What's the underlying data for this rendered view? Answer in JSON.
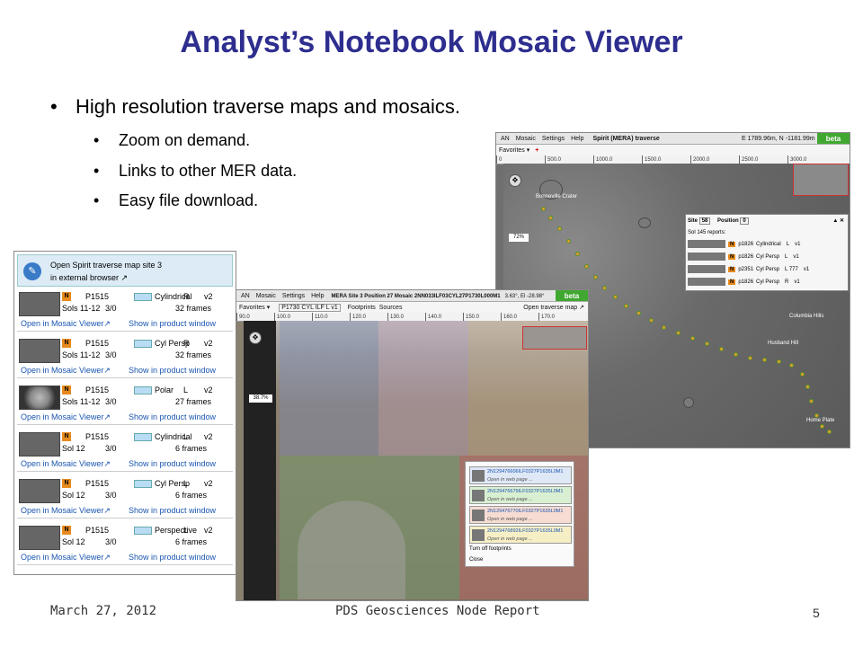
{
  "slide": {
    "title": "Analyst’s Notebook Mosaic Viewer",
    "bullet_main": "High resolution traverse maps and mosaics.",
    "sub_bullets": [
      "Zoom on demand.",
      "Links to other MER data.",
      "Easy file download."
    ],
    "bullet_glyph": "•",
    "footer_date": "March 27, 2012",
    "footer_title": "PDS Geosciences Node Report",
    "page_number": "5"
  },
  "map_window": {
    "menu": [
      "AN",
      "Mosaic",
      "Settings",
      "Help"
    ],
    "title": "Spirit (MERA) traverse",
    "coords": "E 1789.96m, N -1181.99m",
    "beta": "beta",
    "favorites": "Favorites ▾",
    "add": "+",
    "ruler": [
      "0",
      "500.0",
      "1000.0",
      "1500.0",
      "2000.0",
      "2500.0",
      "3000.0"
    ],
    "zoom": "72%",
    "labels": {
      "crater": "Bonneville Crater",
      "hills": "Columbia Hills",
      "husband": "Husband Hill",
      "home": "Home Plate"
    },
    "site_panel": {
      "site_label": "Site",
      "site_value": "58",
      "position_label": "Position",
      "position_value": "0",
      "sol_reports": "Sol 145 reports:",
      "rows": [
        {
          "id": "p1826",
          "proj": "Cylindrical",
          "eye": "L",
          "ver": "v1"
        },
        {
          "id": "p1826",
          "proj": "Cyl Persp",
          "eye": "L",
          "ver": "v1"
        },
        {
          "id": "p2351",
          "proj": "Cyl Persp",
          "eye": "L 777",
          "ver": "v1"
        },
        {
          "id": "p1826",
          "proj": "Cyl Persp",
          "eye": "R",
          "ver": "v1"
        }
      ]
    }
  },
  "product_list": {
    "open_map_line1": "Open Spirit traverse map site 3",
    "open_map_line2": "in external browser ↗",
    "items": [
      {
        "id": "P1515",
        "proj": "Cylindrical",
        "eye": "R",
        "ver": "v2",
        "sols": "Sols 11-12",
        "frac": "3/0",
        "frames": "32 frames",
        "open": "Open in Mosaic Viewer↗",
        "show": "Show in product window"
      },
      {
        "id": "P1515",
        "proj": "Cyl Persp",
        "eye": "R",
        "ver": "v2",
        "sols": "Sols 11-12",
        "frac": "3/0",
        "frames": "32 frames",
        "open": "Open in Mosaic Viewer↗",
        "show": "Show in product window"
      },
      {
        "id": "P1515",
        "proj": "Polar",
        "eye": "L",
        "ver": "v2",
        "sols": "Sols 11-12",
        "frac": "3/0",
        "frames": "27 frames",
        "open": "Open in Mosaic Viewer↗",
        "show": "Show in product window"
      },
      {
        "id": "P1515",
        "proj": "Cylindrical",
        "eye": "L",
        "ver": "v2",
        "sols": "Sol 12",
        "frac": "3/0",
        "frames": "6 frames",
        "open": "Open in Mosaic Viewer↗",
        "show": "Show in product window"
      },
      {
        "id": "P1515",
        "proj": "Cyl Persp",
        "eye": "L",
        "ver": "v2",
        "sols": "Sol 12",
        "frac": "3/0",
        "frames": "6 frames",
        "open": "Open in Mosaic Viewer↗",
        "show": "Show in product window"
      },
      {
        "id": "P1515",
        "proj": "Perspective",
        "eye": "L",
        "ver": "v2",
        "sols": "Sol 12",
        "frac": "3/0",
        "frames": "6 frames",
        "open": "Open in Mosaic Viewer↗",
        "show": "Show in product window"
      }
    ]
  },
  "mosaic_window": {
    "menu": [
      "AN",
      "Mosaic",
      "Settings",
      "Help"
    ],
    "title": "MERA Site 3 Position 27 Mosaic 2NN033ILF03CYL27P1730L000M1",
    "angles": "3.63°, El -28.98°",
    "beta": "beta",
    "favorites": "Favorites ▾",
    "product": "P1730 CYL ILF L v1",
    "footprints": "Footprints",
    "sources": "Sources",
    "open_traverse": "Open traverse map ↗",
    "ruler": [
      "90.0",
      "100.0",
      "110.0",
      "120.0",
      "130.0",
      "140.0",
      "150.0",
      "160.0",
      "170.0"
    ],
    "zoom": "38.7%",
    "footprint_rows": [
      {
        "name": "2N129476606ILF0327P1635L0M1",
        "sub": "Open in web page ..."
      },
      {
        "name": "2N129476679ILF0327P1635L0M1",
        "sub": "Open in web page ..."
      },
      {
        "name": "2N129476770ILF0327P1635L0M1",
        "sub": "Open in web page ..."
      },
      {
        "name": "2N129476892ILF0327P1635L0M1",
        "sub": "Open in web page ..."
      }
    ],
    "turn_off": "Turn off footprints",
    "close": "Close"
  },
  "colors": {
    "title": "#2e2e8f",
    "beta": "#40a830",
    "link": "#1a55b0",
    "traverse": "#e3a02a"
  }
}
